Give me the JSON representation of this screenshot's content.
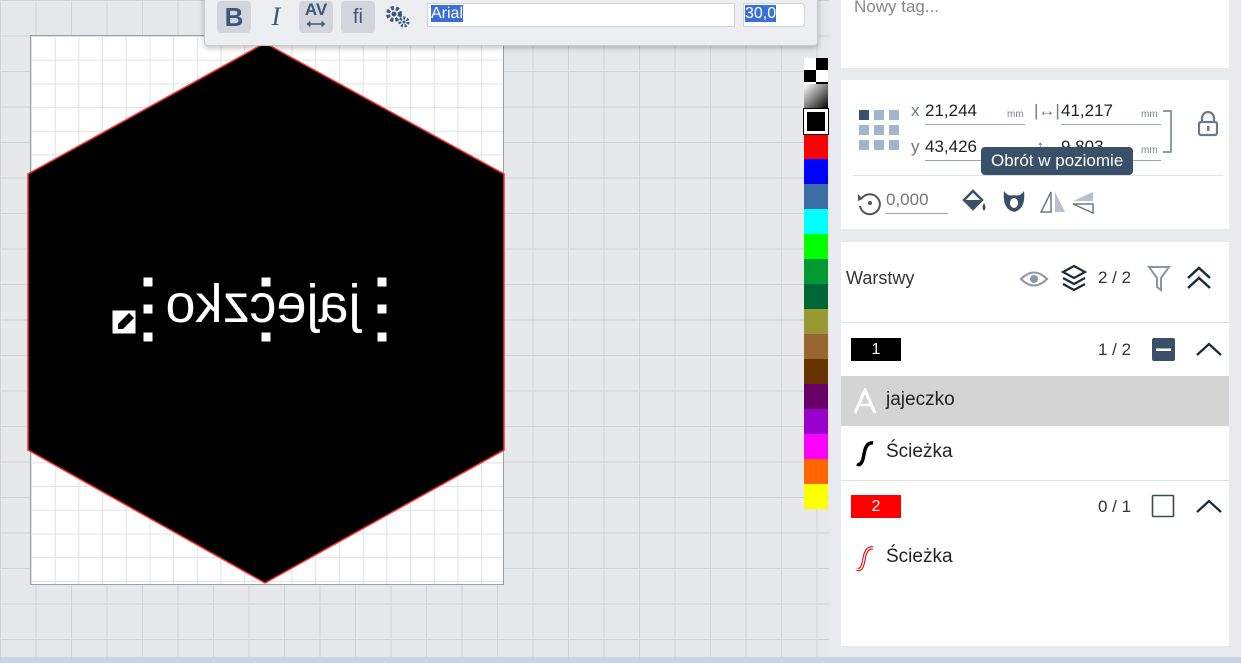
{
  "toolbar": {
    "bold_label": "B",
    "italic_label": "I",
    "kerning_label": "AV",
    "ligature_label": "fi",
    "font_value": "Arial",
    "size_value": "30,0"
  },
  "canvas": {
    "text_content": "jajeczko"
  },
  "palette": {
    "colors": [
      "#000000",
      "#ff0000",
      "#0000ff",
      "#3a6ea5",
      "#00ffff",
      "#00ff00",
      "#009933",
      "#006633",
      "#999933",
      "#996633",
      "#663300",
      "#660066",
      "#9900cc",
      "#ff00ff",
      "#ff6600",
      "#ffff00"
    ]
  },
  "tags": {
    "placeholder": "Nowy tag..."
  },
  "transform": {
    "x_label": "x",
    "x_value": "21,244",
    "y_label": "y",
    "y_value": "43,426",
    "width_value": "41,217",
    "height_value": "9,803",
    "unit": "mm",
    "rotation_value": "0,000",
    "tooltip": "Obrót w poziomie"
  },
  "layers": {
    "title": "Warstwy",
    "count": "2 / 2",
    "groups": [
      {
        "number": "1",
        "color": "#000000",
        "count": "1 / 2",
        "items": [
          {
            "name": "jajeczko",
            "icon": "text-icon"
          },
          {
            "name": "Ścieżka",
            "icon": "path-icon"
          }
        ]
      },
      {
        "number": "2",
        "color": "#ff0000",
        "count": "0 / 1",
        "items": [
          {
            "name": "Ścieżka",
            "icon": "path-icon"
          }
        ]
      }
    ]
  }
}
